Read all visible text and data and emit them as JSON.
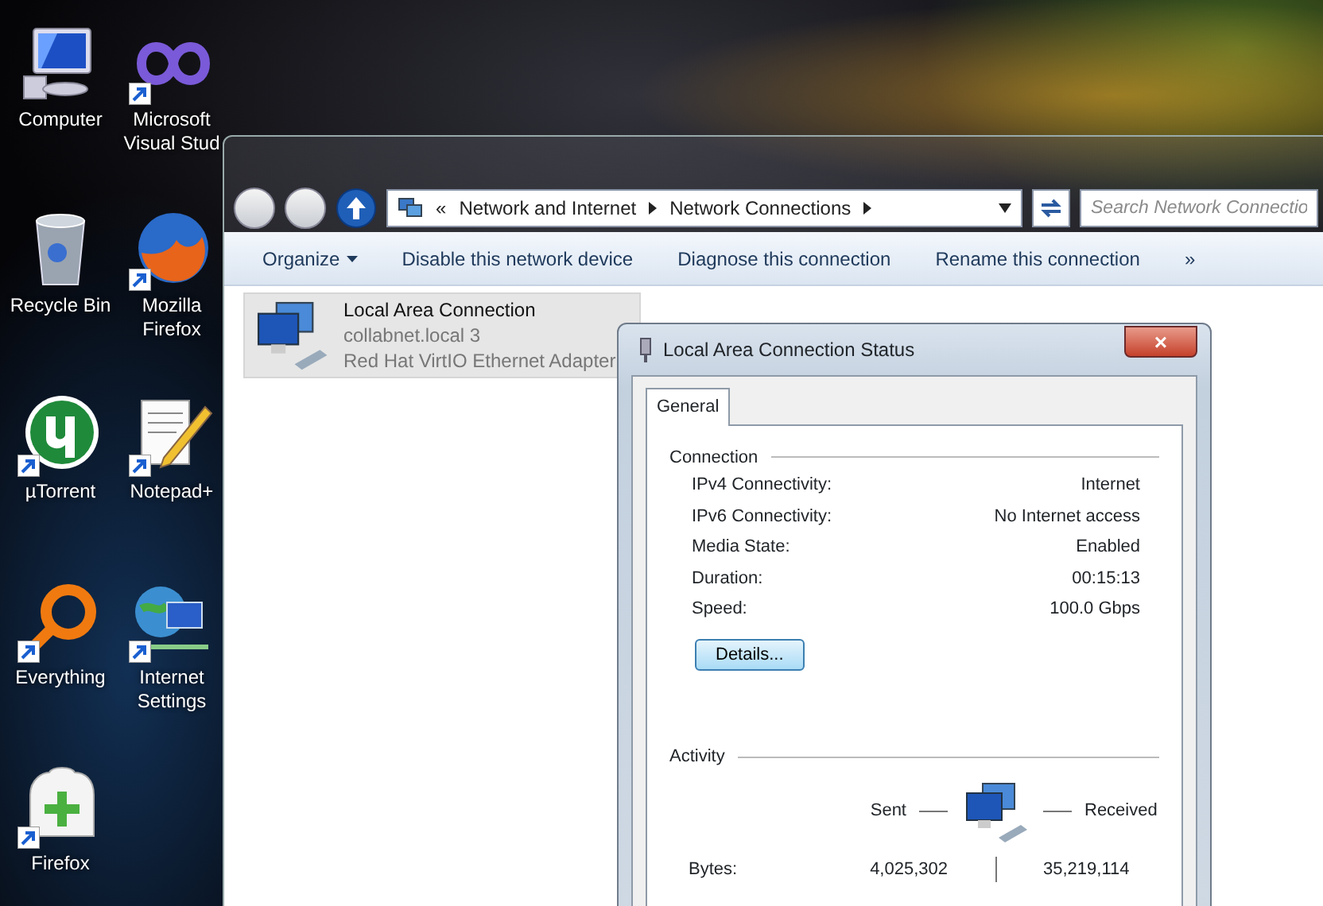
{
  "desktop_icons": [
    {
      "label": "Computer",
      "shortcut": false
    },
    {
      "label": "Microsoft Visual Stud",
      "shortcut": true
    },
    {
      "label": "Recycle Bin",
      "shortcut": false
    },
    {
      "label": "Mozilla Firefox",
      "shortcut": true
    },
    {
      "label": "µTorrent",
      "shortcut": true
    },
    {
      "label": "Notepad+",
      "shortcut": true
    },
    {
      "label": "Everything",
      "shortcut": true
    },
    {
      "label": "Internet Settings",
      "shortcut": true
    },
    {
      "label": "Firefox",
      "shortcut": true
    }
  ],
  "explorer": {
    "address": {
      "overflow": "«",
      "path": [
        "Network and Internet",
        "Network Connections"
      ]
    },
    "search": {
      "placeholder": "Search Network Connectio"
    },
    "toolbar": [
      {
        "label": "Organize",
        "dropdown": true
      },
      {
        "label": "Disable this network device",
        "dropdown": false
      },
      {
        "label": "Diagnose this connection",
        "dropdown": false
      },
      {
        "label": "Rename this connection",
        "dropdown": false
      },
      {
        "label": "»",
        "dropdown": false
      }
    ],
    "connections": [
      {
        "name": "Local Area Connection",
        "network": "collabnet.local  3",
        "adapter": "Red Hat VirtIO Ethernet Adapter",
        "selected": true
      }
    ]
  },
  "dialog": {
    "title": "Local Area Connection Status",
    "close": "×",
    "tabs": [
      {
        "label": "General",
        "selected": true
      }
    ],
    "connection": {
      "heading": "Connection",
      "rows": [
        {
          "label": "IPv4 Connectivity:",
          "value": "Internet"
        },
        {
          "label": "IPv6 Connectivity:",
          "value": "No Internet access"
        },
        {
          "label": "Media State:",
          "value": "Enabled"
        },
        {
          "label": "Duration:",
          "value": "00:15:13"
        },
        {
          "label": "Speed:",
          "value": "100.0 Gbps"
        }
      ],
      "details_button": "Details..."
    },
    "activity": {
      "heading": "Activity",
      "sent_label": "Sent",
      "received_label": "Received",
      "bytes_label": "Bytes:",
      "sent": "4,025,302",
      "received": "35,219,114"
    }
  }
}
